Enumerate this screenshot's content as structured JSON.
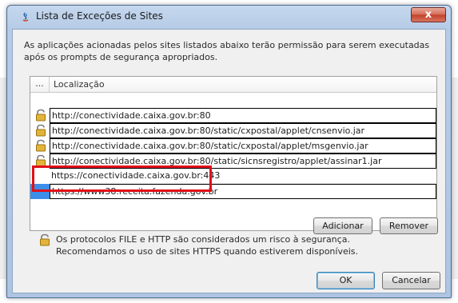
{
  "window": {
    "title": "Lista de Exceções de Sites",
    "close_label": "x"
  },
  "description": "As aplicações acionadas pelos sites listados abaixo terão permissão para serem executadas após os prompts de segurança apropriados.",
  "table": {
    "col_dots": "...",
    "col_location": "Localização",
    "rows": [
      {
        "url": "http://conectividade.caixa.gov.br:80",
        "icon": "lock-icon",
        "boxed": true
      },
      {
        "url": "http://conectividade.caixa.gov.br:80/static/cxpostal/applet/cnsenvio.jar",
        "icon": "lock-icon",
        "boxed": true
      },
      {
        "url": "http://conectividade.caixa.gov.br:80/static/cxpostal/applet/msgenvio.jar",
        "icon": "lock-icon",
        "boxed": true
      },
      {
        "url": "http://conectividade.caixa.gov.br:80/static/sicnsregistro/applet/assinar1.jar",
        "icon": "lock-icon",
        "boxed": true
      },
      {
        "url": "https://conectividade.caixa.gov.br:443",
        "icon": "",
        "boxed": false
      },
      {
        "url": "https://www38.receita.fazenda.gov.br",
        "icon": "",
        "boxed": true,
        "selected": true
      }
    ]
  },
  "buttons": {
    "add": "Adicionar",
    "remove": "Remover",
    "ok": "OK",
    "cancel": "Cancelar"
  },
  "footer": {
    "line1": "Os protocolos FILE e HTTP são considerados um risco à segurança.",
    "line2": "Recomendamos o uso de sites HTTPS quando estiverem disponíveis."
  },
  "colors": {
    "selection": "#3d8ee8",
    "highlight": "#e0101a"
  }
}
